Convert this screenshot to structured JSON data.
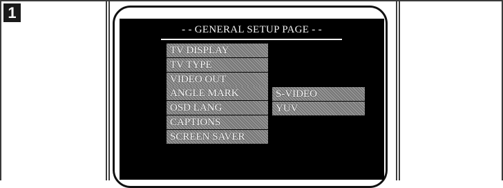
{
  "step": {
    "number": "1"
  },
  "screen": {
    "title": "- - GENERAL SETUP PAGE - -",
    "menu_items": [
      "TV DISPLAY",
      "TV TYPE",
      "VIDEO OUT",
      "ANGLE MARK",
      "OSD LANG",
      "CAPTIONS",
      "SCREEN SAVER"
    ],
    "options": [
      "S-VIDEO",
      "YUV"
    ]
  },
  "colors": {
    "screen_bg": "#000000",
    "highlight": "#8a8a8a",
    "text": "#ffffff",
    "frame": "#3a3a3a"
  }
}
